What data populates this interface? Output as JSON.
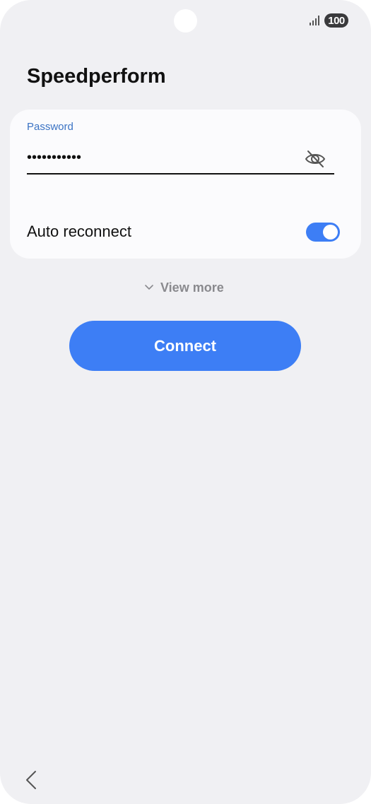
{
  "status_bar": {
    "battery_level": "100",
    "icons": [
      "front-camera",
      "signal-icon",
      "battery-icon"
    ]
  },
  "header": {
    "title": "Speedperform"
  },
  "form": {
    "password_label": "Password",
    "password_value": "•••••••••••",
    "visibility_icon": "eye-off-icon",
    "auto_reconnect_label": "Auto reconnect",
    "auto_reconnect_on": true
  },
  "view_more": {
    "label": "View more",
    "icon": "chevron-down-icon"
  },
  "connect_button": {
    "label": "Connect"
  },
  "nav": {
    "back_icon": "back-chevron-icon"
  },
  "colors": {
    "accent": "#3d7ef5",
    "label_blue": "#3b73c4",
    "background": "#f0f0f3",
    "card": "#fbfbfd"
  }
}
